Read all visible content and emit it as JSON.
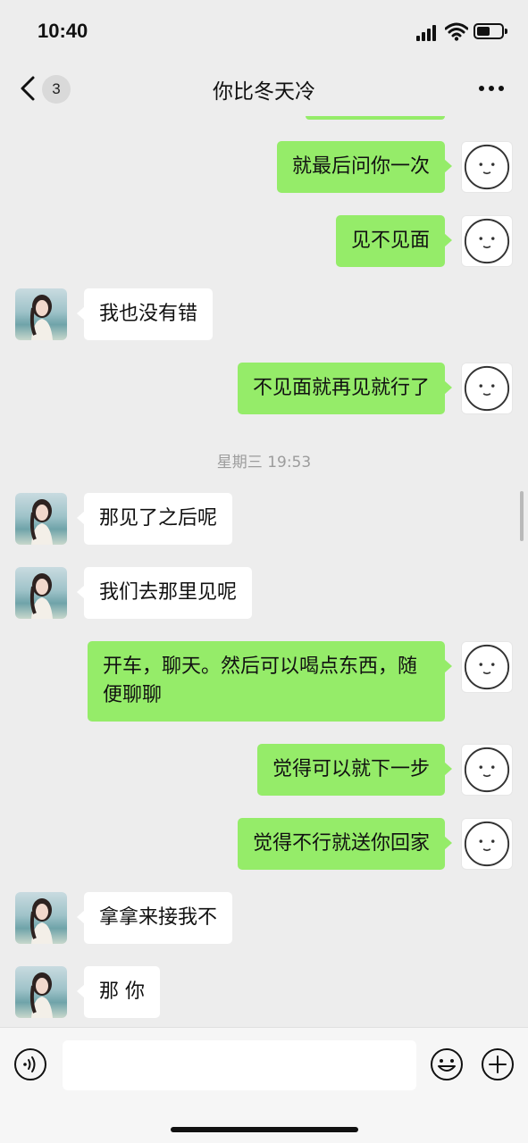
{
  "status_bar": {
    "time": "10:40"
  },
  "nav": {
    "unread_count": "3",
    "title": "你比冬天冷"
  },
  "icons": {
    "back": "chevron-left-icon",
    "more": "more-dots-icon",
    "voice": "voice-icon",
    "emoji": "emoji-icon",
    "plus": "plus-icon"
  },
  "colors": {
    "my_bubble": "#95ec69",
    "their_bubble": "#ffffff",
    "background": "#ededed"
  },
  "messages": [
    {
      "from": "me",
      "text": "就最后问你一次"
    },
    {
      "from": "me",
      "text": "见不见面"
    },
    {
      "from": "them",
      "text": "我也没有错"
    },
    {
      "from": "me",
      "text": "不见面就再见就行了"
    },
    {
      "from": "time",
      "text": "星期三 19:53"
    },
    {
      "from": "them",
      "text": "那见了之后呢"
    },
    {
      "from": "them",
      "text": "我们去那里见呢"
    },
    {
      "from": "me",
      "text": "开车，聊天。然后可以喝点东西，随便聊聊"
    },
    {
      "from": "me",
      "text": "觉得可以就下一步"
    },
    {
      "from": "me",
      "text": "觉得不行就送你回家"
    },
    {
      "from": "them",
      "text": "拿拿来接我不"
    },
    {
      "from": "them",
      "text": "那 你"
    }
  ],
  "input": {
    "value": ""
  }
}
